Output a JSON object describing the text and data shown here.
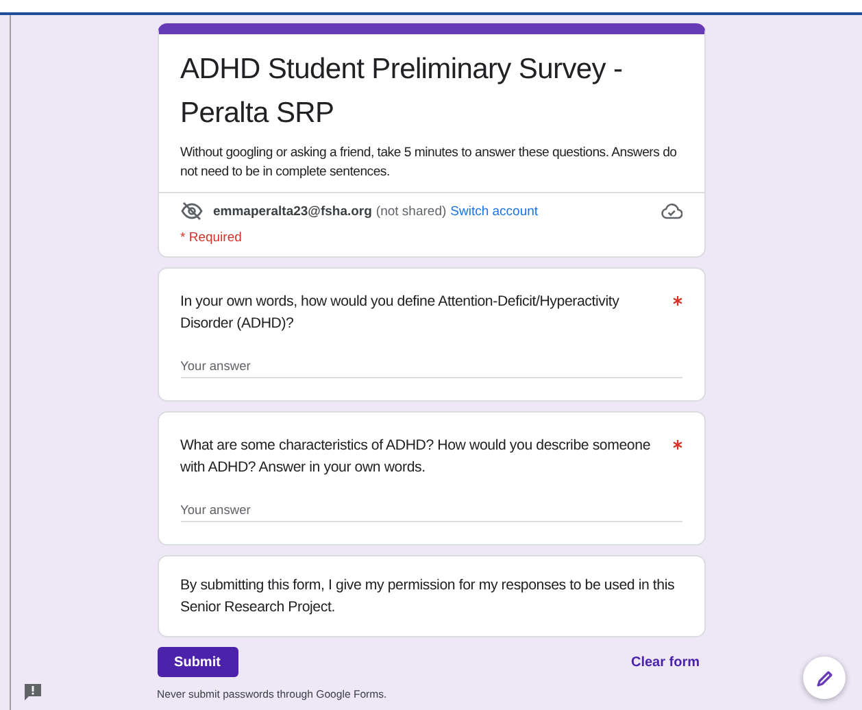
{
  "form": {
    "title": "ADHD Student Preliminary Survey - Peralta SRP",
    "description": "Without googling or asking a friend, take 5 minutes to answer these questions. Answers do not need to be in complete sentences.",
    "account": {
      "email": "emmaperalta23@fsha.org",
      "note": "(not shared)",
      "switch_label": "Switch account"
    },
    "required_note": "* Required"
  },
  "questions": [
    {
      "text": "In your own words, how would you define Attention-Deficit/Hyperactivity Disorder (ADHD)?",
      "required": true,
      "placeholder": "Your answer"
    },
    {
      "text": "What are some characteristics of ADHD? How would you describe someone with ADHD? Answer in your own words.",
      "required": true,
      "placeholder": "Your answer"
    }
  ],
  "consent": "By submitting this form, I give my permission for my responses to be used in this Senior Research Project.",
  "actions": {
    "submit": "Submit",
    "clear": "Clear form"
  },
  "footer": "Never submit passwords through Google Forms."
}
